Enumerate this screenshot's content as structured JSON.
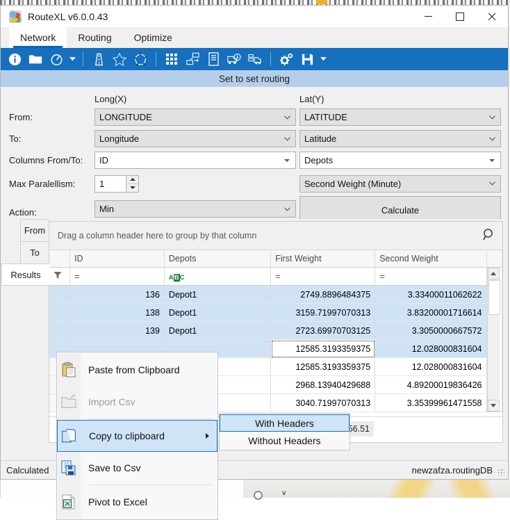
{
  "window": {
    "title": "RouteXL v6.0.0.43",
    "icon": "app-logo-icon",
    "minimize": "─",
    "maximize": "□",
    "close": "✕"
  },
  "menu": {
    "items": [
      {
        "label": "Network",
        "active": true
      },
      {
        "label": "Routing",
        "active": false
      },
      {
        "label": "Optimize",
        "active": false
      }
    ]
  },
  "toolbar": {
    "buttons": [
      {
        "name": "info-icon"
      },
      {
        "name": "open-folder-icon"
      },
      {
        "name": "compass-icon"
      },
      {
        "name": "compass-dropdown-caret-icon"
      },
      {
        "name": "road-icon"
      },
      {
        "name": "star-icon"
      },
      {
        "name": "polygon-icon"
      },
      {
        "name": "matrix-grid-icon"
      },
      {
        "name": "set-to-set-routing-icon"
      },
      {
        "name": "document-icon"
      },
      {
        "name": "vehicle-clock-icon"
      },
      {
        "name": "fleet-truck-icon"
      },
      {
        "name": "settings-gears-icon"
      },
      {
        "name": "save-disk-icon"
      },
      {
        "name": "overflow-caret-icon"
      }
    ]
  },
  "panel": {
    "header": "Set to set routing",
    "column_headers": {
      "x": "Long(X)",
      "y": "Lat(Y)"
    },
    "rows": [
      {
        "label": "From:",
        "left_value": "LONGITUDE",
        "right_value": "LATITUDE"
      },
      {
        "label": "To:",
        "left_value": "Longitude",
        "right_value": "Latitude"
      },
      {
        "label": "Columns From/To:",
        "left_value": "ID",
        "right_value": "Depots"
      },
      {
        "label": "Max Paralellism:",
        "left_value": "1",
        "right_value": "Second Weight (Minute)"
      },
      {
        "label": "Action:",
        "left_value": "Min",
        "right_value": "Calculate"
      }
    ]
  },
  "side_tabs": [
    {
      "label": "From",
      "selected": false
    },
    {
      "label": "To",
      "selected": false
    },
    {
      "label": "Results",
      "selected": true
    }
  ],
  "grid": {
    "group_hint": "Drag a column header here to group by that column",
    "find_icon": "search-icon",
    "columns": [
      "ID",
      "Depots",
      "First Weight",
      "Second Weight"
    ],
    "filter_row": {
      "funnel_icon": "filter-funnel-icon",
      "id": "=",
      "depots": "abc",
      "first_weight": "=",
      "second_weight": "="
    },
    "rows": [
      {
        "id": "136",
        "depots": "Depot1",
        "first_weight": "2749.8896484375",
        "second_weight": "3.33400011062622",
        "selected": true,
        "focused": false
      },
      {
        "id": "138",
        "depots": "Depot1",
        "first_weight": "3159.71997070313",
        "second_weight": "3.83200001716614",
        "selected": true,
        "focused": false
      },
      {
        "id": "139",
        "depots": "Depot1",
        "first_weight": "2723.69970703125",
        "second_weight": "3.3050000667572",
        "selected": true,
        "focused": false
      },
      {
        "id": "",
        "depots": "",
        "first_weight": "12585.3193359375",
        "second_weight": "12.028000831604",
        "selected": true,
        "focused": true
      },
      {
        "id": "",
        "depots": "",
        "first_weight": "12585.3193359375",
        "second_weight": "12.028000831604",
        "selected": false,
        "focused": false
      },
      {
        "id": "",
        "depots": "",
        "first_weight": "2968.13940429688",
        "second_weight": "4.89200019836426",
        "selected": false,
        "focused": false
      },
      {
        "id": "",
        "depots": "",
        "first_weight": "3040.71997070313",
        "second_weight": "3.35399961471558",
        "selected": false,
        "focused": false
      }
    ],
    "summary_value": "356.51",
    "scroll_up_icon": "scroll-up-arrow-icon",
    "scroll_down_icon": "scroll-down-arrow-icon"
  },
  "context_menu": {
    "items": [
      {
        "label": "Paste from Clipboard",
        "icon": "paste-clipboard-icon",
        "disabled": false,
        "highlighted": false,
        "submenu": false
      },
      {
        "label": "Import Csv",
        "icon": "import-csv-folder-icon",
        "disabled": true,
        "highlighted": false,
        "submenu": false
      },
      {
        "label": "Copy to clipboard",
        "icon": "copy-clipboard-icon",
        "disabled": false,
        "highlighted": true,
        "submenu": true
      },
      {
        "label": "Save to Csv",
        "icon": "save-csv-disk-icon",
        "disabled": false,
        "highlighted": false,
        "submenu": false
      },
      {
        "label": "Pivot to Excel",
        "icon": "excel-pivot-icon",
        "disabled": false,
        "highlighted": false,
        "submenu": false
      }
    ],
    "submenu": {
      "items": [
        {
          "label": "With Headers",
          "highlighted": true
        },
        {
          "label": "Without Headers",
          "highlighted": false
        }
      ]
    }
  },
  "statusbar": {
    "left": "Calculated",
    "right": "newzafza.routingDB"
  },
  "colors": {
    "toolbar_blue": "#1670bd",
    "section_header": "#b5cfea",
    "selection": "#cfe3f5",
    "menu_highlight": "#cfe5f7",
    "accent": "#0a66b5"
  }
}
